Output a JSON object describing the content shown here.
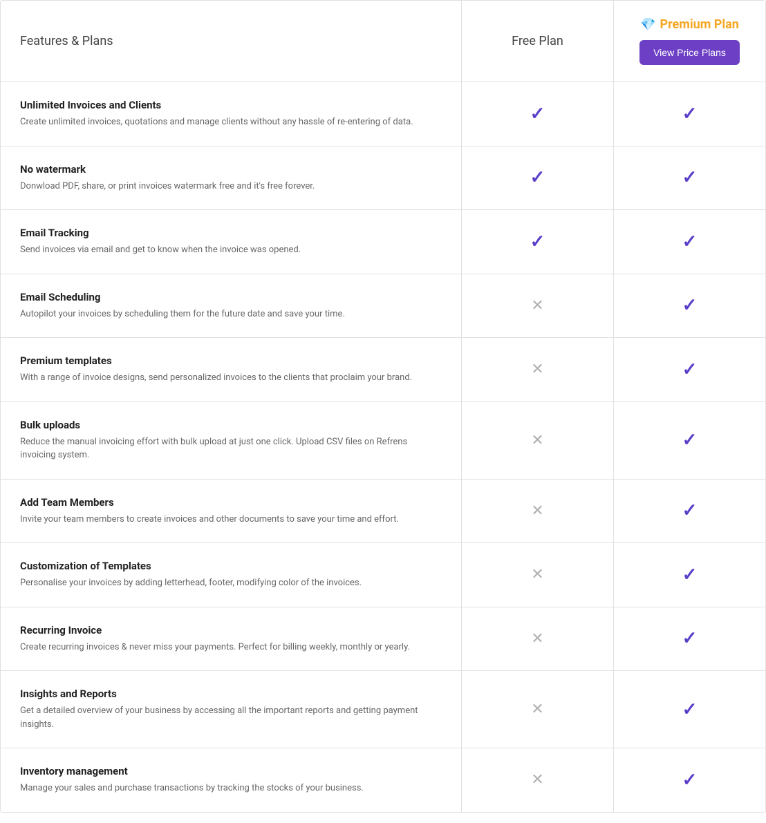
{
  "header": {
    "features_label": "Features & Plans",
    "free_plan_label": "Free Plan",
    "premium_label": "Premium Plan",
    "view_price_btn": "View Price Plans"
  },
  "features": [
    {
      "name": "Unlimited Invoices and Clients",
      "detail": "Create unlimited invoices, quotations and manage clients without any hassle of re-entering of data.",
      "free": true,
      "premium": true
    },
    {
      "name": "No watermark",
      "detail": "Donwload PDF, share, or print invoices watermark free and it's free forever.",
      "free": true,
      "premium": true
    },
    {
      "name": "Email Tracking",
      "detail": "Send invoices via email and get to know when the invoice was opened.",
      "free": true,
      "premium": true
    },
    {
      "name": "Email Scheduling",
      "detail": "Autopilot your invoices by scheduling them for the future date and save your time.",
      "free": false,
      "premium": true
    },
    {
      "name": "Premium templates",
      "detail": "With a range of invoice designs, send personalized invoices to the clients that proclaim your brand.",
      "free": false,
      "premium": true
    },
    {
      "name": "Bulk uploads",
      "detail": "Reduce the manual invoicing effort with bulk upload at just one click. Upload CSV files on Refrens invoicing system.",
      "free": false,
      "premium": true
    },
    {
      "name": "Add Team Members",
      "detail": "Invite your team members to create invoices and other documents to save your time and effort.",
      "free": false,
      "premium": true
    },
    {
      "name": "Customization of Templates",
      "detail": "Personalise your invoices by adding letterhead, footer, modifying color of the invoices.",
      "free": false,
      "premium": true
    },
    {
      "name": "Recurring Invoice",
      "detail": "Create recurring invoices & never miss your payments. Perfect for billing weekly, monthly or yearly.",
      "free": false,
      "premium": true
    },
    {
      "name": "Insights and Reports",
      "detail": "Get a detailed overview of your business by accessing all the important reports and getting payment insights.",
      "free": false,
      "premium": true
    },
    {
      "name": "Inventory management",
      "detail": "Manage your sales and purchase transactions by tracking the stocks of your business.",
      "free": false,
      "premium": true
    }
  ]
}
